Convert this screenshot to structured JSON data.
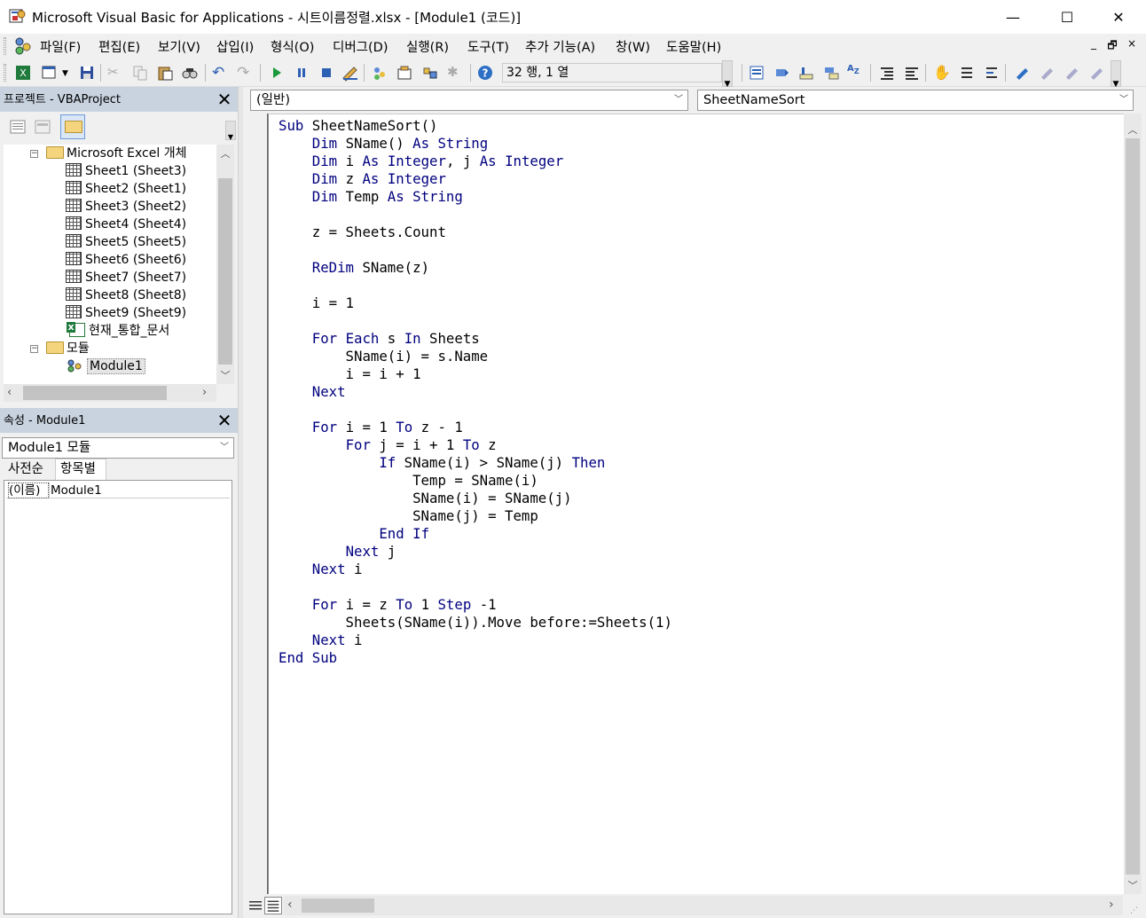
{
  "window": {
    "title": "Microsoft Visual Basic for Applications - 시트이름정렬.xlsx - [Module1 (코드)]",
    "minimize": "—",
    "maximize": "☐",
    "close": "✕"
  },
  "menu": {
    "items": [
      "파일(F)",
      "편집(E)",
      "보기(V)",
      "삽입(I)",
      "형식(O)",
      "디버그(D)",
      "실행(R)",
      "도구(T)",
      "추가 기능(A)",
      "창(W)",
      "도움말(H)"
    ],
    "mdi_min": "_",
    "mdi_restore": "🗗",
    "mdi_close": "×"
  },
  "toolbar": {
    "cursor_position": "32 행, 1 열"
  },
  "project": {
    "title": "프로젝트 - VBAProject",
    "close": "✕",
    "tree": {
      "excel_objects": "Microsoft Excel 개체",
      "sheets": [
        "Sheet1 (Sheet3)",
        "Sheet2 (Sheet1)",
        "Sheet3 (Sheet2)",
        "Sheet4 (Sheet4)",
        "Sheet5 (Sheet5)",
        "Sheet6 (Sheet6)",
        "Sheet7 (Sheet7)",
        "Sheet8 (Sheet8)",
        "Sheet9 (Sheet9)"
      ],
      "workbook": "현재_통합_문서",
      "modules_folder": "모듈",
      "module": "Module1"
    }
  },
  "properties": {
    "title": "속성 - Module1",
    "close": "✕",
    "object_combo": "Module1 모듈",
    "tabs": [
      "사전순",
      "항목별"
    ],
    "rows": [
      {
        "name": "(이름)",
        "value": "Module1"
      }
    ]
  },
  "code_window": {
    "object_combo": "(일반)",
    "procedure_combo": "SheetNameSort"
  },
  "code_lines": [
    "Sub SheetNameSort()",
    "    Dim SName() As String",
    "    Dim i As Integer, j As Integer",
    "    Dim z As Integer",
    "    Dim Temp As String",
    "",
    "    z = Sheets.Count",
    "",
    "    ReDim SName(z)",
    "",
    "    i = 1",
    "",
    "    For Each s In Sheets",
    "        SName(i) = s.Name",
    "        i = i + 1",
    "    Next",
    "",
    "    For i = 1 To z - 1",
    "        For j = i + 1 To z",
    "            If SName(i) > SName(j) Then",
    "                Temp = SName(i)",
    "                SName(i) = SName(j)",
    "                SName(j) = Temp",
    "            End If",
    "        Next j",
    "    Next i",
    "",
    "    For i = z To 1 Step -1",
    "        Sheets(SName(i)).Move before:=Sheets(1)",
    "    Next i",
    "End Sub"
  ],
  "colors": {
    "keyword": "#00007f",
    "panel_header": "#c8d3df",
    "chrome": "#f0f0f0"
  }
}
